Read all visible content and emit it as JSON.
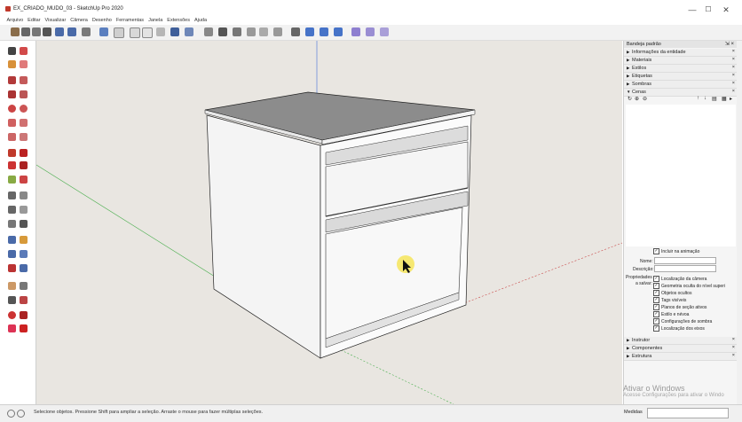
{
  "window": {
    "title": "EX_CRIADO_MUDO_03 - SketchUp Pro 2020",
    "min": "—",
    "max": "☐",
    "close": "✕"
  },
  "menu": [
    "Arquivo",
    "Editar",
    "Visualizar",
    "Câmera",
    "Desenho",
    "Ferramentas",
    "Janela",
    "Extensões",
    "Ajuda"
  ],
  "tray": {
    "title": "Bandeja padrão",
    "pin": "⇲ ×",
    "sections_top": [
      {
        "label": "Informações da entidade",
        "expanded": false
      },
      {
        "label": "Materiais",
        "expanded": false
      },
      {
        "label": "Estilos",
        "expanded": false
      },
      {
        "label": "Etiquetas",
        "expanded": false
      },
      {
        "label": "Sombras",
        "expanded": false
      },
      {
        "label": "Cenas",
        "expanded": true
      }
    ],
    "sections_bottom": [
      {
        "label": "Instrutor",
        "expanded": false
      },
      {
        "label": "Componentes",
        "expanded": false
      },
      {
        "label": "Estrutura",
        "expanded": false
      }
    ],
    "scenes": {
      "include_animation": "Incluir na animação",
      "name_label": "Nome:",
      "description_label": "Descrição:",
      "properties_label_1": "Propriedades",
      "properties_label_2": "a salvar:",
      "properties": [
        "Localização da câmera",
        "Geometria oculta do nível superi",
        "Objetos ocultos",
        "Tags visíveis",
        "Planos de seção ativos",
        "Estilo e névoa",
        "Configurações de sombra",
        "Localização dos eixos"
      ]
    }
  },
  "watermark": {
    "title": "Ativar o Windows",
    "sub": "Acesse Configurações para ativar o Windo"
  },
  "status": {
    "message": "Selecione objetos. Pressione Shift para ampliar a seleção. Arraste o mouse para fazer múltiplas seleções.",
    "measure_label": "Medidas"
  },
  "colors": {
    "viewport": "#e9e6e1",
    "cursor_highlight": "#f5e663",
    "axis_red": "#c94a4a",
    "axis_green": "#4caf50",
    "axis_blue": "#5b7fd8"
  }
}
